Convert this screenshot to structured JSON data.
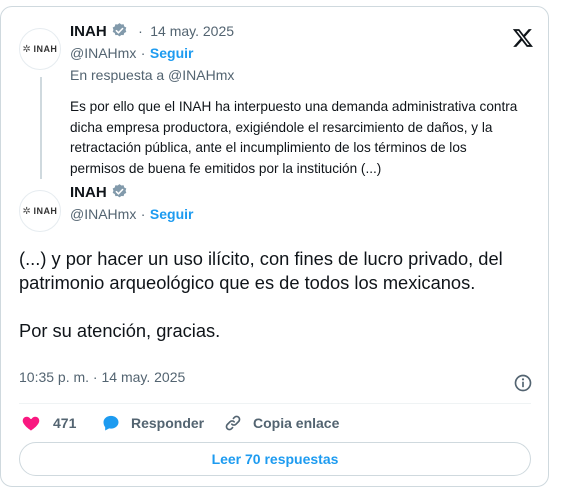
{
  "reply_tweet": {
    "author_name": "INAH",
    "avatar_text": "INAH",
    "date_separator": "·",
    "date": "14 may. 2025",
    "handle": "@INAHmx",
    "handle_separator": "·",
    "follow_label": "Seguir",
    "in_reply_to": "En respuesta a @INAHmx",
    "text": "Es por ello que el INAH ha interpuesto una demanda administrativa contra dicha empresa productora, exigiéndole el resarcimiento de daños, y la retractación pública, ante el incumplimiento de los términos de los permisos de buena fe emitidos por la institución (...)"
  },
  "main_tweet": {
    "author_name": "INAH",
    "avatar_text": "INAH",
    "handle": "@INAHmx",
    "handle_separator": "·",
    "follow_label": "Seguir",
    "paragraph_1": "(...) y por hacer un uso ilícito, con fines de lucro privado, del patrimonio arqueológico que es de todos los mexicanos.",
    "paragraph_2": "Por su atención, gracias.",
    "timestamp": "10:35 p. m. · 14 may. 2025"
  },
  "actions": {
    "like_count": "471",
    "reply_label": "Responder",
    "copy_link_label": "Copia enlace",
    "read_replies_label": "Leer 70 respuestas"
  },
  "colors": {
    "accent": "#1d9bf0",
    "like": "#f91880",
    "muted": "#536471",
    "border": "#cfd9de"
  },
  "icons": [
    "x-logo-icon",
    "verified-badge-icon",
    "info-icon",
    "heart-icon",
    "reply-bubble-icon",
    "link-icon"
  ]
}
